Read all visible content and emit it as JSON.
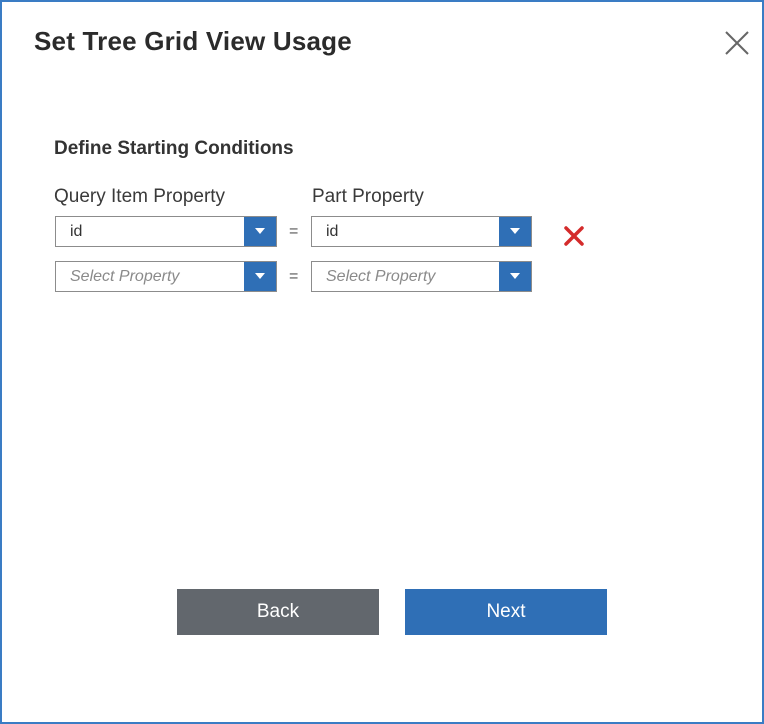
{
  "dialog": {
    "title": "Set Tree Grid View Usage",
    "close_icon": "close-icon"
  },
  "section": {
    "heading": "Define Starting Conditions",
    "left_column_label": "Query Item Property",
    "right_column_label": "Part Property"
  },
  "conditions": [
    {
      "query_item_value": "id",
      "equals": "=",
      "part_value": "id",
      "remove_icon": "remove-x-icon"
    },
    {
      "query_item_placeholder": "Select Property",
      "equals": "=",
      "part_placeholder": "Select Property"
    }
  ],
  "buttons": {
    "back": "Back",
    "next": "Next"
  },
  "colors": {
    "border": "#3a7cc4",
    "accent": "#2f6fb6",
    "back_button": "#62676d",
    "remove_icon": "#d42b2b"
  }
}
